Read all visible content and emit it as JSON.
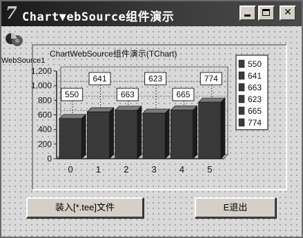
{
  "window": {
    "icon_glyph": "7",
    "title": "Chart▼ebSource组件演示",
    "controls": {
      "minimize": "minimize-icon",
      "maximize": "maximize-icon",
      "close_glyph": "✕"
    }
  },
  "component": {
    "label": "WebSource1",
    "icon": "chart-component-icon"
  },
  "chart_data": {
    "type": "bar",
    "title": "ChartWebSource组件演示(TChart)",
    "categories": [
      "0",
      "1",
      "2",
      "3",
      "4",
      "5"
    ],
    "values": [
      550,
      641,
      663,
      623,
      665,
      774
    ],
    "data_labels": [
      "550",
      "641",
      "663",
      "623",
      "665",
      "774"
    ],
    "ylim": [
      0,
      1200
    ],
    "yticks": [
      0,
      200,
      400,
      600,
      800,
      1000,
      1200
    ],
    "ytick_labels": [
      "0",
      "200",
      "400",
      "600",
      "800",
      "1,000",
      "1,200"
    ],
    "legend": [
      "550",
      "641",
      "663",
      "623",
      "665",
      "774"
    ],
    "legend_position": "right",
    "grid": true,
    "bar_style": "3d",
    "colors": {
      "bar": "#3a3a3a",
      "bar_top": "#7a7a7a",
      "bar_side": "#1c1c1c"
    }
  },
  "buttons": {
    "load": "装入[*.tee]文件",
    "exit": "E退出"
  }
}
